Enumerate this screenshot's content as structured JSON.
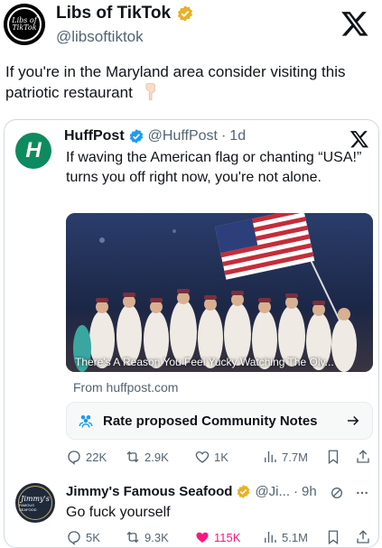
{
  "outer_post": {
    "avatar_text": "Libs of TikTok",
    "name": "Libs of TikTok",
    "handle": "@libsoftiktok",
    "text": "If you're in the Maryland area consider visiting this patriotic restaurant",
    "emoji_icon": "pointing-down-hand-icon",
    "verified_color": "#e8b124"
  },
  "quoted_post": {
    "avatar_letter": "H",
    "name": "HuffPost",
    "handle": "@HuffPost",
    "separator": "·",
    "time": "1d",
    "text": "If waving the American flag or chanting “USA!” turns you off right now, you're not alone.",
    "media_caption": "There's A Reason You Feel Yucky Watching The Oly...",
    "media_source": "From huffpost.com",
    "community_notes_label": "Rate proposed Community Notes",
    "actions": {
      "replies": "22K",
      "reposts": "2.9K",
      "likes": "1K",
      "views": "7.7M"
    },
    "brand_color": "#0e8a5f",
    "verified_color": "#1d9bf0"
  },
  "reply_post": {
    "avatar_text": "Jimmy's",
    "avatar_subtext": "FAMOUS SEAFOOD",
    "name": "Jimmy's Famous Seafood",
    "handle": "@Ji...",
    "separator": "·",
    "time": "9h",
    "text": "Go fuck yourself",
    "actions": {
      "replies": "5K",
      "reposts": "9.3K",
      "likes": "115K",
      "views": "5.1M"
    },
    "like_color": "#f91880"
  }
}
